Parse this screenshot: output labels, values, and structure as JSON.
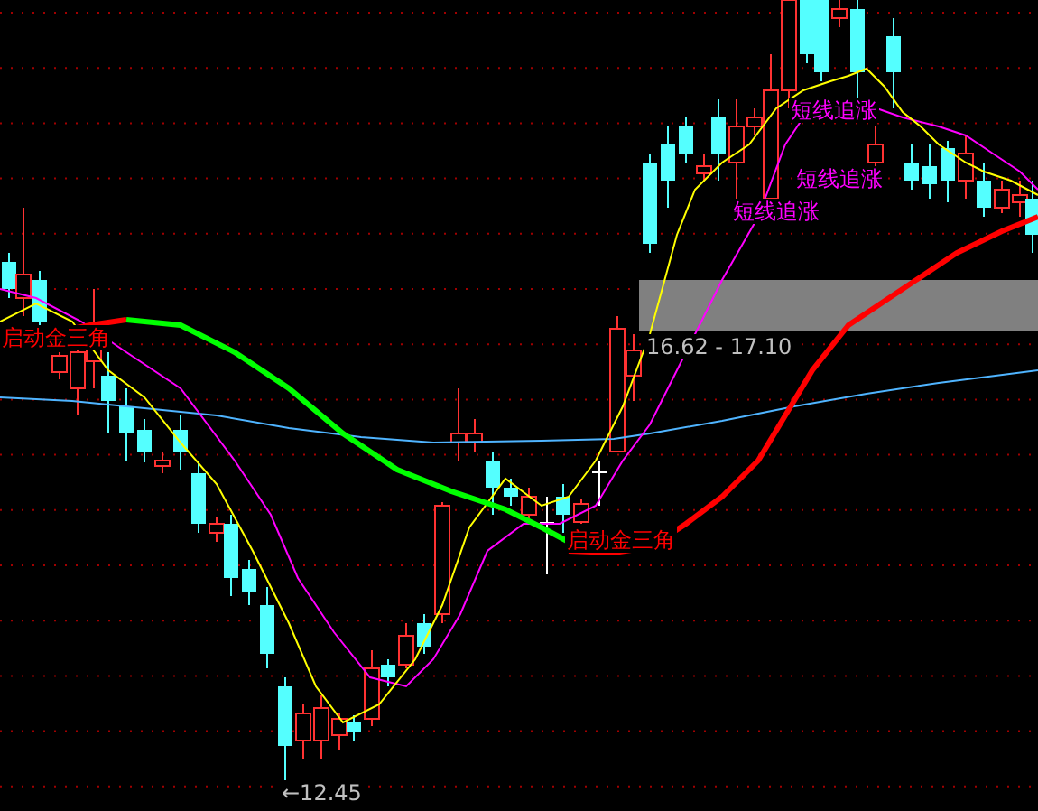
{
  "chart": {
    "signal_labels": [
      {
        "text": "短线追涨",
        "color": "#ff00ff"
      },
      {
        "text": "短线追涨",
        "color": "#ff00ff"
      },
      {
        "text": "短线追涨",
        "color": "#ff00ff"
      },
      {
        "text": "启动金三角",
        "color": "#ff0000"
      },
      {
        "text": "启动金三角",
        "color": "#ff0000"
      }
    ],
    "price_labels": [
      {
        "text": "16.62 - 17.10"
      },
      {
        "text": "←12.45"
      }
    ]
  }
}
